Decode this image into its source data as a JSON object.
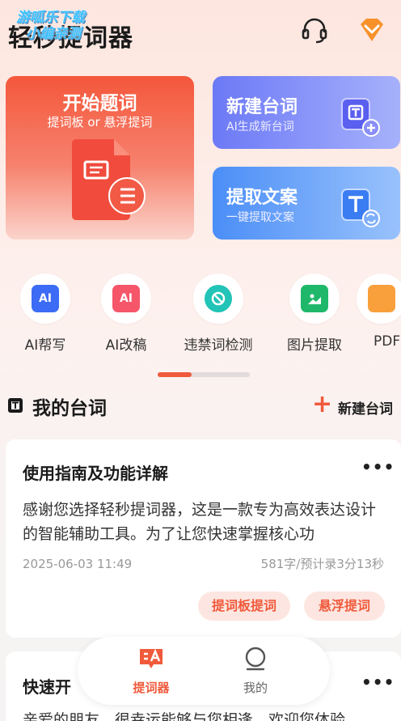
{
  "header": {
    "app_title": "轻秒提词器",
    "watermark_line1": "游呱乐下载",
    "watermark_line2": "小编亲测",
    "service_icon": "headset-icon",
    "vip_icon": "diamond-icon"
  },
  "cards": {
    "start": {
      "title": "开始题词",
      "subtitle": "提词板 or 悬浮提词"
    },
    "new_script": {
      "title": "新建台词",
      "subtitle": "AI生成新台词"
    },
    "extract": {
      "title": "提取文案",
      "subtitle": "一键提取文案"
    }
  },
  "tools": [
    {
      "label": "AI帮写",
      "icon": "ai-write-icon",
      "color": "#3c6cf5"
    },
    {
      "label": "AI改稿",
      "icon": "ai-edit-icon",
      "color": "#f5566a"
    },
    {
      "label": "违禁词检测",
      "icon": "forbidden-word-check-icon",
      "color": "#21c4b6"
    },
    {
      "label": "图片提取",
      "icon": "image-extract-icon",
      "color": "#1fb86a"
    },
    {
      "label": "PDF",
      "icon": "pdf-icon",
      "color": "#f9a03c"
    }
  ],
  "pager": {
    "pages": 2,
    "active": 1
  },
  "my_scripts": {
    "title": "我的台词",
    "new_label": "新建台词",
    "items": [
      {
        "title": "使用指南及功能详解",
        "body": "感谢您选择轻秒提词器，这是一款专为高效表达设计的智能辅助工具。为了让您快速掌握核心功",
        "date": "2025-06-03 11:49",
        "count": "581字/预计录3分13秒",
        "tag1": "提词板提词",
        "tag2": "悬浮提词"
      },
      {
        "title": "快速开",
        "body": "亲爱的朋友，很幸运能够与您相逢，欢迎您体验"
      }
    ]
  },
  "bottom_nav": {
    "item1": "提词器",
    "item2": "我的"
  },
  "colors": {
    "accent": "#f05a3c"
  }
}
